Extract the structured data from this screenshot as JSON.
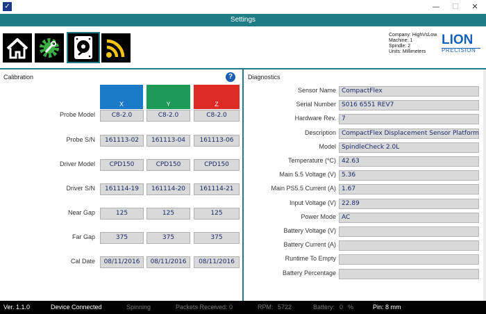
{
  "window": {
    "icon": "checkbox-app-icon",
    "minimize": "—",
    "maximize": "☐",
    "close": "✕"
  },
  "header": {
    "title": "Settings"
  },
  "toolbar": {
    "buttons": [
      {
        "icon": "home-icon"
      },
      {
        "icon": "gear-wrench-icon"
      },
      {
        "icon": "disk-drive-icon"
      },
      {
        "icon": "rss-feed-icon"
      }
    ]
  },
  "meta": {
    "company": "Company: HighVsLow",
    "machine": "Machine: 1",
    "spindle": "Spindle: 2",
    "units": "Units: Millimeters"
  },
  "logo": {
    "top": "LION",
    "bottom": "PRECISION"
  },
  "calibration": {
    "title": "Calibration",
    "help": "?",
    "axes": {
      "x": "X",
      "y": "Y",
      "z": "Z"
    },
    "axis_colors": {
      "x": "#1b7ac8",
      "y": "#1d9a55",
      "z": "#de2a25"
    },
    "rows": [
      {
        "label": "Probe Model",
        "x": "C8-2.0",
        "y": "C8-2.0",
        "z": "C8-2.0"
      },
      {
        "label": "Probe S/N",
        "x": "161113-02",
        "y": "161113-04",
        "z": "161113-06"
      },
      {
        "label": "Driver Model",
        "x": "CPD150",
        "y": "CPD150",
        "z": "CPD150"
      },
      {
        "label": "Driver S/N",
        "x": "161114-19",
        "y": "161114-20",
        "z": "161114-21"
      },
      {
        "label": "Near Gap",
        "x": "125",
        "y": "125",
        "z": "125"
      },
      {
        "label": "Far Gap",
        "x": "375",
        "y": "375",
        "z": "375"
      },
      {
        "label": "Cal Date",
        "x": "08/11/2016",
        "y": "08/11/2016",
        "z": "08/11/2016"
      }
    ]
  },
  "diagnostics": {
    "title": "Diagnostics",
    "rows": [
      {
        "label": "Sensor Name",
        "value": "CompactFlex"
      },
      {
        "label": "Serial Number",
        "value": "S016 6551 REV7"
      },
      {
        "label": "Hardware Rev.",
        "value": "7"
      },
      {
        "label": "Description",
        "value": "CompactFlex Displacement Sensor Platform"
      },
      {
        "label": "Model",
        "value": "SpindleCheck 2.0L"
      },
      {
        "label": "Temperature (*C)",
        "value": "42.63"
      },
      {
        "label": "Main 5.5 Voltage (V)",
        "value": "5.36"
      },
      {
        "label": "Main PS5.5 Current (A)",
        "value": "1.67"
      },
      {
        "label": "Input Voltage (V)",
        "value": "22.89"
      },
      {
        "label": "Power Mode",
        "value": "AC"
      },
      {
        "label": "Battery Voltage (V)",
        "value": ""
      },
      {
        "label": "Battery Current (A)",
        "value": ""
      },
      {
        "label": "Runtime To Empty",
        "value": ""
      },
      {
        "label": "Battery Percentage",
        "value": ""
      }
    ]
  },
  "status": {
    "version": "Ver. 1.1.0",
    "connection": "Device Connected",
    "spinning": "Spinning",
    "packets_label": "Packets Received:",
    "packets_value": "0",
    "rpm_label": "RPM:",
    "rpm_value": "5722",
    "battery_label": "Battery:",
    "battery_value": "0",
    "battery_unit": "%",
    "pin": "Pin: 8 mm"
  }
}
